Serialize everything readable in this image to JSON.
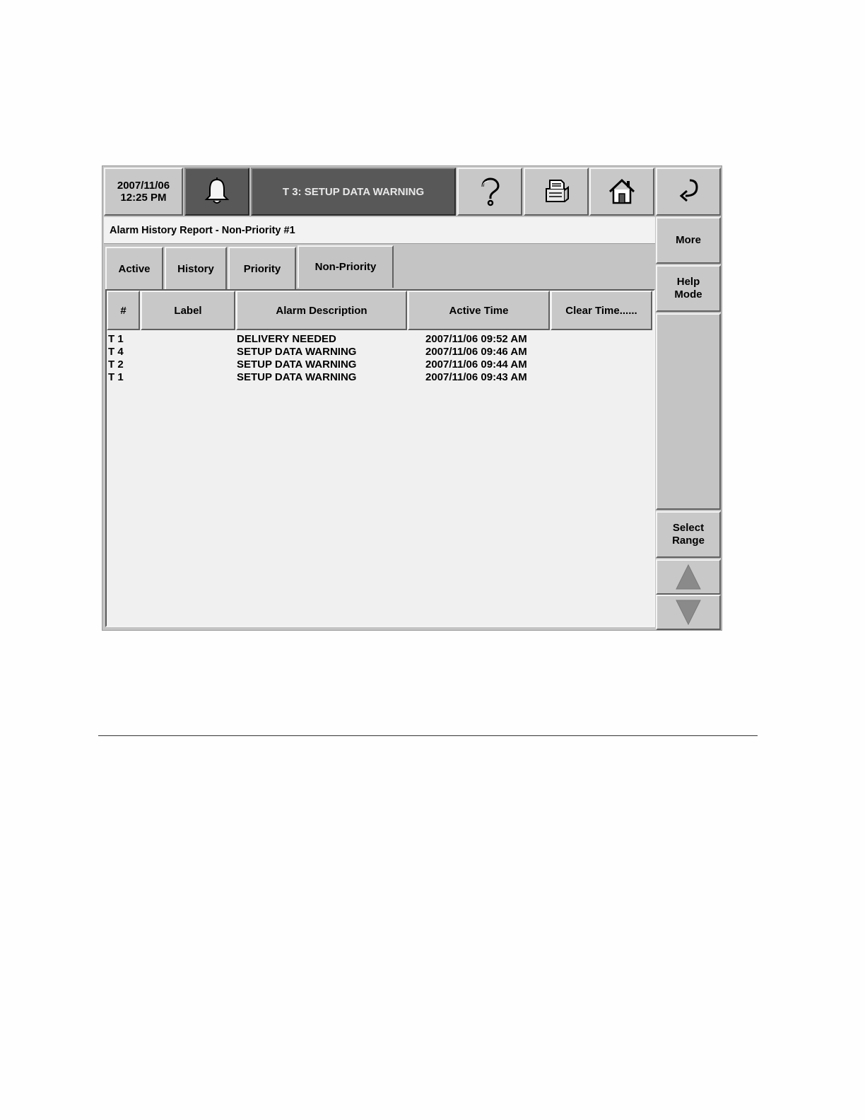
{
  "header": {
    "date": "2007/11/06",
    "time": "12:25 PM",
    "status_message": "T 3: SETUP DATA WARNING",
    "icons": [
      "bell-icon",
      "help-icon",
      "printer-icon",
      "home-icon",
      "back-arrow-icon"
    ]
  },
  "report": {
    "title": "Alarm History Report  - Non-Priority #1"
  },
  "tabs": [
    {
      "label": "Active"
    },
    {
      "label": "History"
    },
    {
      "label": "Priority"
    },
    {
      "label": "Non-Priority",
      "selected": true
    }
  ],
  "table": {
    "columns": [
      "#",
      "Label",
      "Alarm Description",
      "Active Time",
      "Clear Time......"
    ],
    "rows": [
      {
        "num": "T 1",
        "label": "",
        "description": "DELIVERY NEEDED",
        "active_time": "2007/11/06 09:52 AM",
        "clear_time": ""
      },
      {
        "num": "T 4",
        "label": "",
        "description": "SETUP DATA WARNING",
        "active_time": "2007/11/06 09:46 AM",
        "clear_time": ""
      },
      {
        "num": "T 2",
        "label": "",
        "description": "SETUP DATA WARNING",
        "active_time": "2007/11/06 09:44 AM",
        "clear_time": ""
      },
      {
        "num": "T 1",
        "label": "",
        "description": "SETUP DATA WARNING",
        "active_time": "2007/11/06 09:43 AM",
        "clear_time": ""
      }
    ]
  },
  "sidebar": {
    "more": "More",
    "help_mode_line1": "Help",
    "help_mode_line2": "Mode",
    "select_range_line1": "Select",
    "select_range_line2": "Range",
    "scroll_icons": [
      "triangle-up-icon",
      "triangle-down-icon"
    ]
  },
  "colors": {
    "panel": "#c4c4c4",
    "status_bar": "#585858",
    "table_background": "#f0f0f0"
  }
}
